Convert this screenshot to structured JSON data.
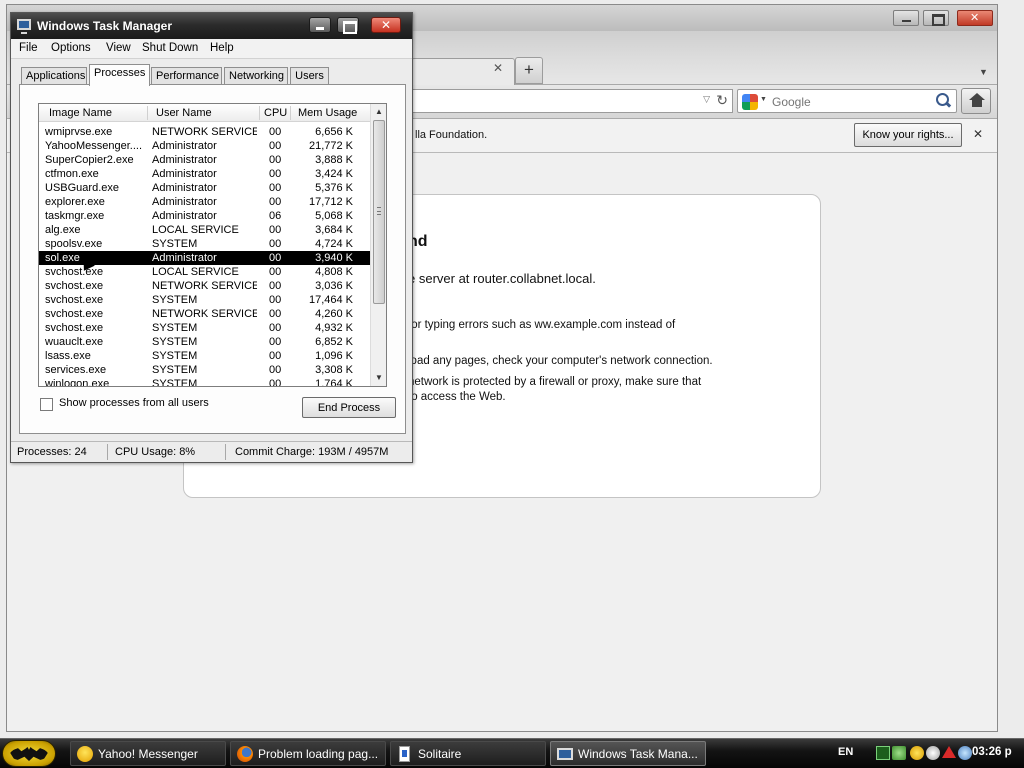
{
  "firefox": {
    "search_placeholder": "Google",
    "notification_text": "lla Foundation.",
    "notification_button": "Know your rights...",
    "tab_close_glyph": "✕",
    "new_tab_glyph": "+",
    "notify_close_glyph": "✕",
    "error": {
      "title": "nd",
      "description": "e server at router.collabnet.local.",
      "lines": [
        "for typing errors such as ww.example.com instead of",
        "",
        "load any pages, check your computer's network connection.",
        "network is protected by a firewall or proxy, make sure that",
        "to access the Web."
      ]
    }
  },
  "task_manager": {
    "title": "Windows Task Manager",
    "menu": [
      "File",
      "Options",
      "View",
      "Shut Down",
      "Help"
    ],
    "tabs": [
      "Applications",
      "Processes",
      "Performance",
      "Networking",
      "Users"
    ],
    "active_tab": "Processes",
    "columns": [
      "Image Name",
      "User Name",
      "CPU",
      "Mem Usage"
    ],
    "processes": [
      {
        "name": "wmiprvse.exe",
        "user": "NETWORK SERVICE",
        "cpu": "00",
        "mem": "6,656 K"
      },
      {
        "name": "YahooMessenger....",
        "user": "Administrator",
        "cpu": "00",
        "mem": "21,772 K"
      },
      {
        "name": "SuperCopier2.exe",
        "user": "Administrator",
        "cpu": "00",
        "mem": "3,888 K"
      },
      {
        "name": "ctfmon.exe",
        "user": "Administrator",
        "cpu": "00",
        "mem": "3,424 K"
      },
      {
        "name": "USBGuard.exe",
        "user": "Administrator",
        "cpu": "00",
        "mem": "5,376 K"
      },
      {
        "name": "explorer.exe",
        "user": "Administrator",
        "cpu": "00",
        "mem": "17,712 K"
      },
      {
        "name": "taskmgr.exe",
        "user": "Administrator",
        "cpu": "06",
        "mem": "5,068 K"
      },
      {
        "name": "alg.exe",
        "user": "LOCAL SERVICE",
        "cpu": "00",
        "mem": "3,684 K"
      },
      {
        "name": "spoolsv.exe",
        "user": "SYSTEM",
        "cpu": "00",
        "mem": "4,724 K"
      },
      {
        "name": "sol.exe",
        "user": "Administrator",
        "cpu": "00",
        "mem": "3,940 K",
        "selected": true
      },
      {
        "name": "svchost.exe",
        "user": "LOCAL SERVICE",
        "cpu": "00",
        "mem": "4,808 K"
      },
      {
        "name": "svchost.exe",
        "user": "NETWORK SERVICE",
        "cpu": "00",
        "mem": "3,036 K"
      },
      {
        "name": "svchost.exe",
        "user": "SYSTEM",
        "cpu": "00",
        "mem": "17,464 K"
      },
      {
        "name": "svchost.exe",
        "user": "NETWORK SERVICE",
        "cpu": "00",
        "mem": "4,260 K"
      },
      {
        "name": "svchost.exe",
        "user": "SYSTEM",
        "cpu": "00",
        "mem": "4,932 K"
      },
      {
        "name": "wuauclt.exe",
        "user": "SYSTEM",
        "cpu": "00",
        "mem": "6,852 K"
      },
      {
        "name": "lsass.exe",
        "user": "SYSTEM",
        "cpu": "00",
        "mem": "1,096 K"
      },
      {
        "name": "services.exe",
        "user": "SYSTEM",
        "cpu": "00",
        "mem": "3,308 K"
      },
      {
        "name": "winlogon.exe",
        "user": "SYSTEM",
        "cpu": "00",
        "mem": "1,764 K"
      }
    ],
    "show_all_label": "Show processes from all users",
    "show_all_checked": false,
    "end_process_label": "End Process",
    "status": {
      "processes": "Processes: 24",
      "cpu_usage": "CPU Usage: 8%",
      "commit_charge": "Commit Charge: 193M / 4957M"
    }
  },
  "taskbar": {
    "buttons": [
      {
        "label": "Yahoo! Messenger",
        "icon": "yahoo-messenger-icon"
      },
      {
        "label": "Problem loading pag...",
        "icon": "firefox-icon"
      },
      {
        "label": "Solitaire",
        "icon": "solitaire-icon"
      },
      {
        "label": "Windows Task Mana...",
        "icon": "task-manager-icon",
        "active": true
      }
    ],
    "language": "EN",
    "clock": "03:26 p"
  }
}
